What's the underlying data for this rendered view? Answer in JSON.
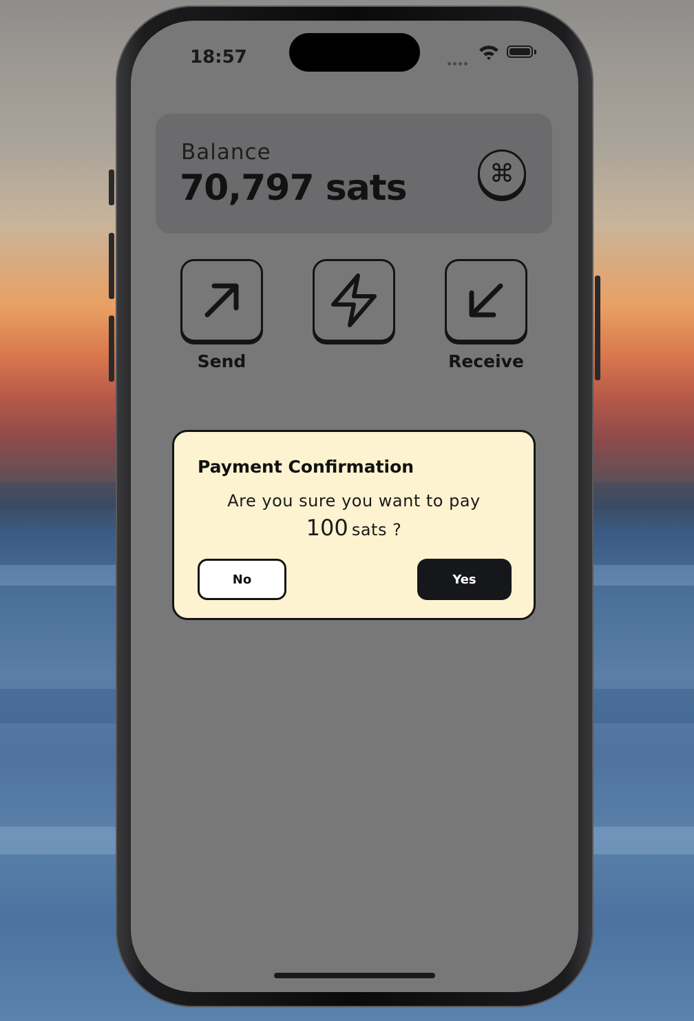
{
  "status_bar": {
    "time": "18:57",
    "icons": [
      "signal-dots-icon",
      "wifi-icon",
      "battery-icon"
    ]
  },
  "balance": {
    "label": "Balance",
    "value": "70,797 sats",
    "action_icon": "command-icon",
    "action_glyph": "⌘"
  },
  "actions": [
    {
      "label": "Send",
      "icon": "arrow-up-right-icon"
    },
    {
      "label": "",
      "icon": "lightning-icon"
    },
    {
      "label": "Receive",
      "icon": "arrow-down-left-icon"
    }
  ],
  "modal": {
    "title": "Payment Confirmation",
    "question": "Are you sure you want to pay",
    "amount": "100",
    "unit": "sats ?",
    "no_label": "No",
    "yes_label": "Yes"
  },
  "colors": {
    "screen_overlay": "#787878",
    "modal_background": "#fdf3d0",
    "primary_dark": "#16171b"
  }
}
